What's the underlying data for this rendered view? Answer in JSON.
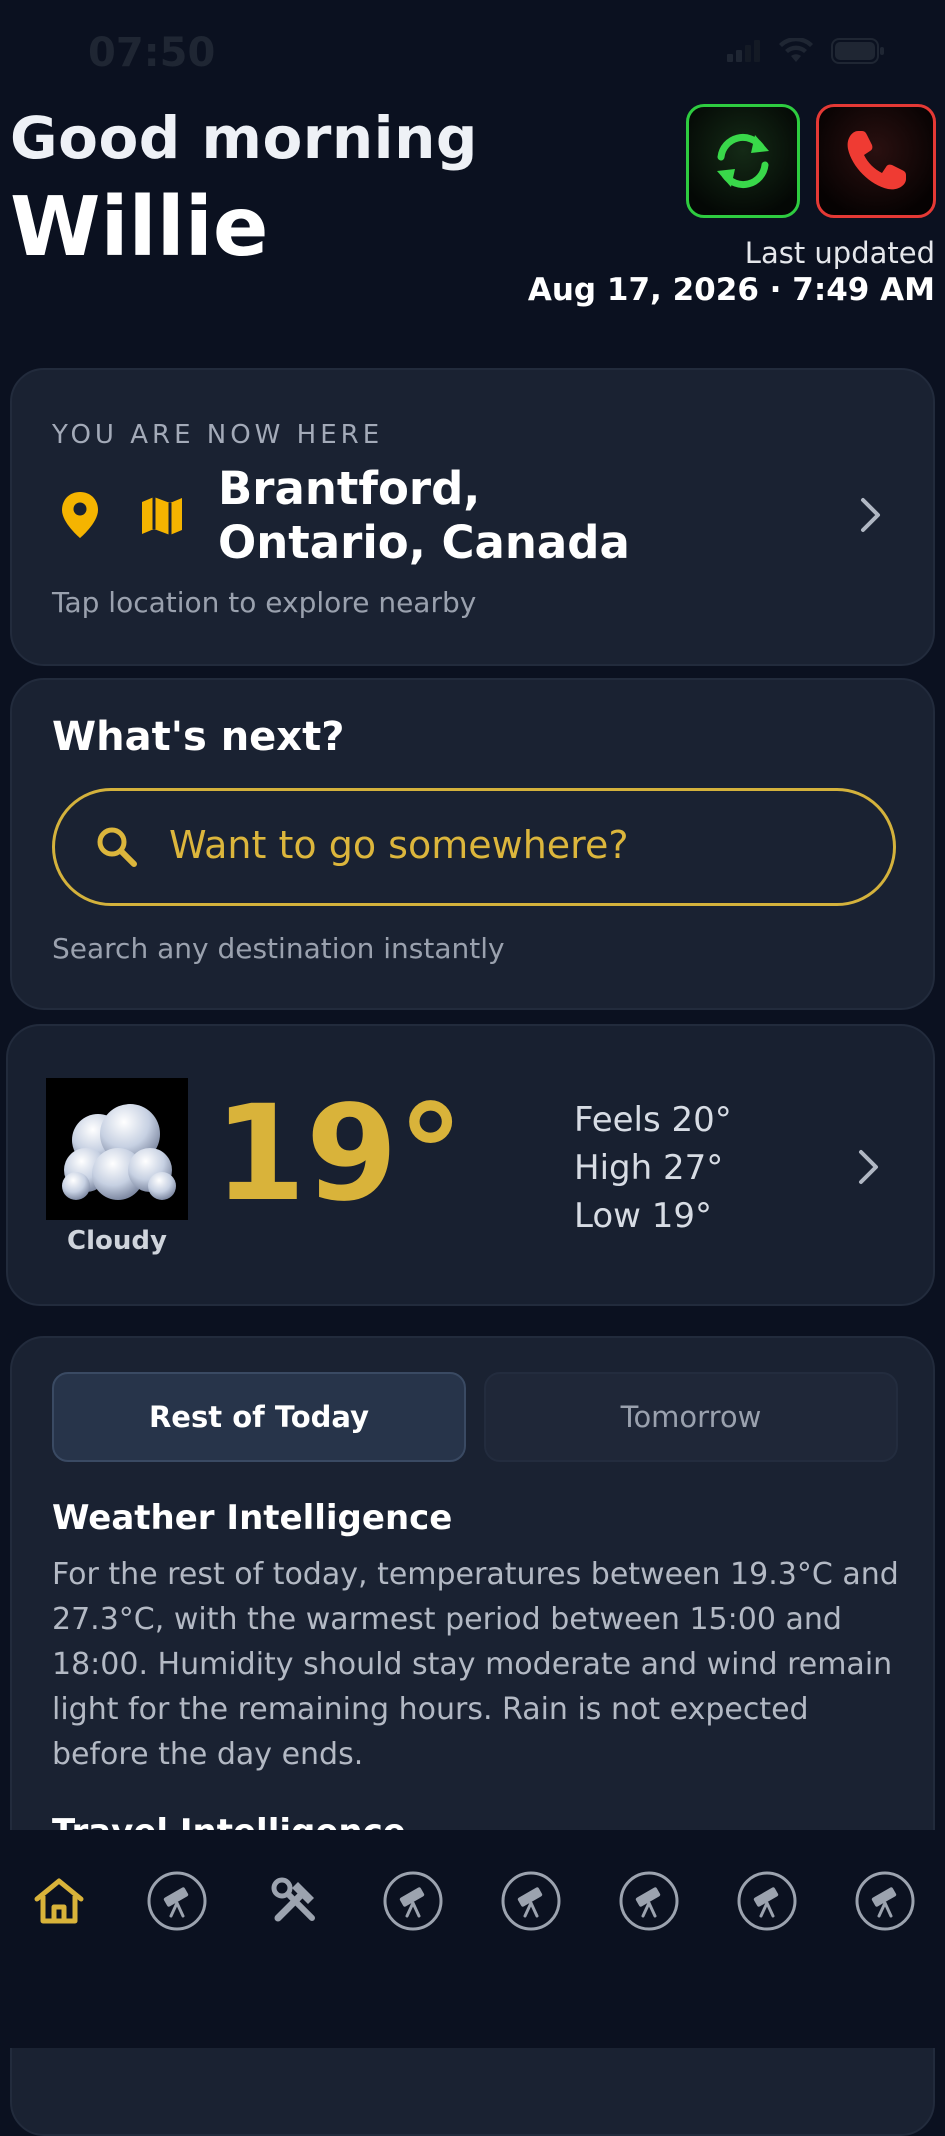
{
  "status_bar": {
    "time": "07:50"
  },
  "header": {
    "greeting": "Good morning",
    "name": "Willie",
    "last_updated_label": "Last updated",
    "last_updated_value": "Aug 17, 2026 · 7:49 AM",
    "refresh_icon": "refresh-icon",
    "call_icon": "phone-icon",
    "accent_refresh": "#2ecc40",
    "accent_call": "#e53935"
  },
  "location": {
    "heading": "YOU ARE NOW HERE",
    "name": "Brantford, Ontario, Canada",
    "hint": "Tap location to explore nearby",
    "accent": "#f5b400"
  },
  "next": {
    "title": "What's next?",
    "search_placeholder": "Want to go somewhere?",
    "hint": "Search any destination instantly",
    "accent": "#d4b23c"
  },
  "weather": {
    "condition": "Cloudy",
    "temperature": "19°",
    "feels": "Feels 20°",
    "high": "High 27°",
    "low": "Low 19°"
  },
  "intel": {
    "tabs": [
      {
        "label": "Rest of Today",
        "active": true
      },
      {
        "label": "Tomorrow",
        "active": false
      }
    ],
    "weather_title": "Weather Intelligence",
    "weather_text": "For the rest of today, temperatures between 19.3°C and 27.3°C, with the warmest period between 15:00 and 18:00. Humidity should stay moderate and wind remain light for the remaining hours. Rain is not expected before the day ends.",
    "travel_title": "Travel Intelligence"
  },
  "nav": {
    "items": [
      {
        "icon": "home-icon",
        "active": true
      },
      {
        "icon": "telescope-icon",
        "active": false
      },
      {
        "icon": "tools-icon",
        "active": false
      },
      {
        "icon": "telescope-icon",
        "active": false
      },
      {
        "icon": "telescope-icon",
        "active": false
      },
      {
        "icon": "telescope-icon",
        "active": false
      },
      {
        "icon": "telescope-icon",
        "active": false
      },
      {
        "icon": "telescope-icon",
        "active": false
      }
    ],
    "active_color": "#d9b33a",
    "inactive_color": "#9ca3af"
  }
}
